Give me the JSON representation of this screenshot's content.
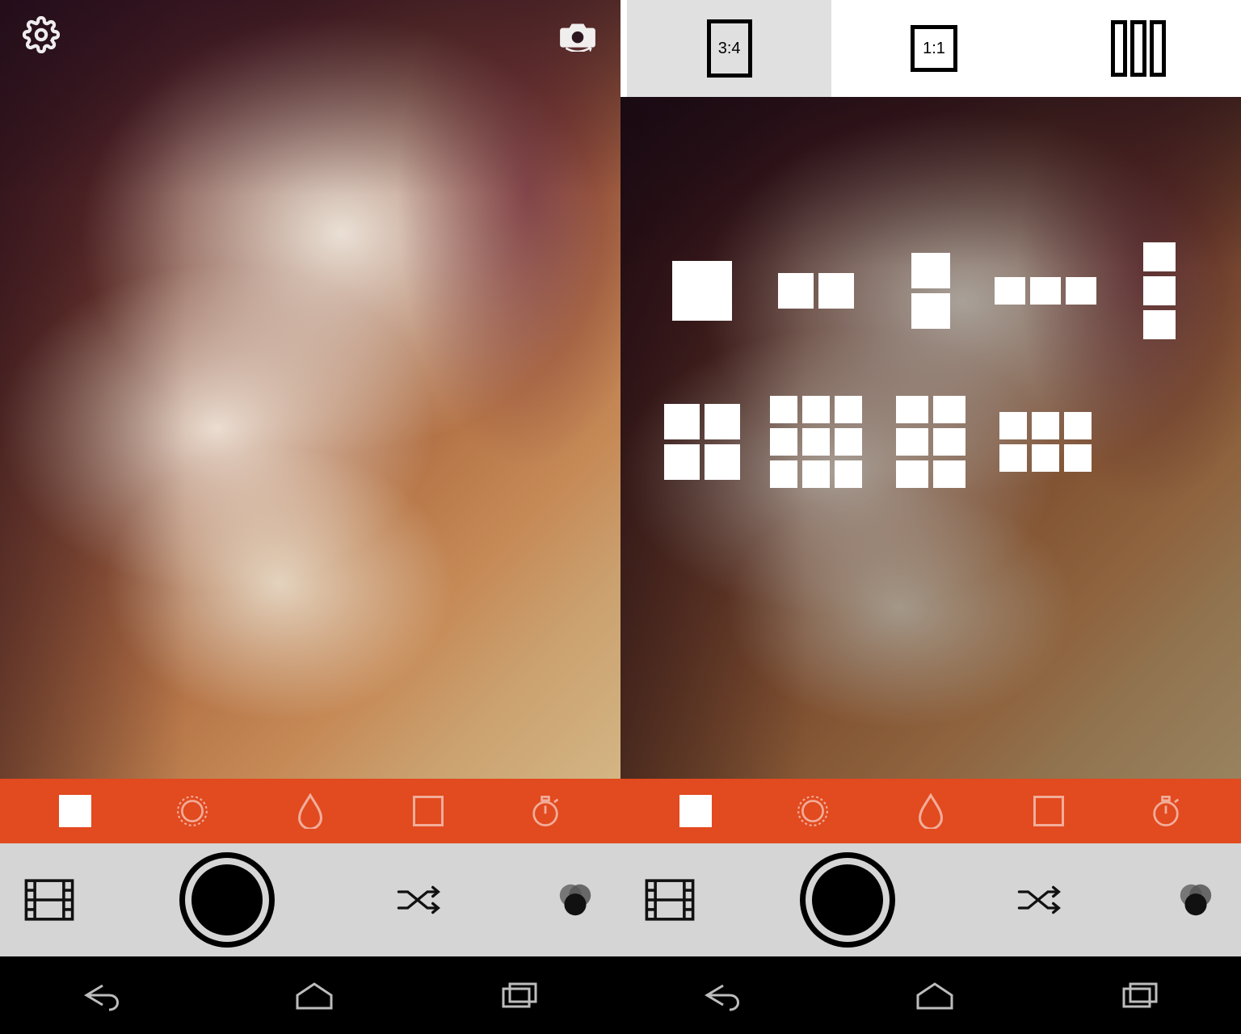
{
  "left": {
    "top_icons": {
      "settings": "gear-icon",
      "flip": "camera-flip-icon"
    },
    "filter_tabs": [
      "layout",
      "lens",
      "drop",
      "vignette",
      "timer"
    ],
    "filter_active": 0,
    "controls": {
      "gallery": "filmstrip-icon",
      "shutter": "shutter-button",
      "shuffle": "shuffle-icon",
      "color": "color-filter-icon"
    },
    "nav": [
      "back",
      "home",
      "recents"
    ]
  },
  "right": {
    "aspect": {
      "options": [
        {
          "id": "3-4",
          "label": "3:4",
          "selected": true
        },
        {
          "id": "1-1",
          "label": "1:1",
          "selected": false
        },
        {
          "id": "strip",
          "label": "",
          "selected": false
        }
      ]
    },
    "layouts": [
      "1x1",
      "2x1",
      "1x2",
      "3x1",
      "1x3",
      "2x2",
      "3x3",
      "2x3",
      "3x2"
    ],
    "filter_tabs": [
      "layout",
      "lens",
      "drop",
      "vignette",
      "timer"
    ],
    "filter_active": 0,
    "controls": {
      "gallery": "filmstrip-icon",
      "shutter": "shutter-button",
      "shuffle": "shuffle-icon",
      "color": "color-filter-icon"
    },
    "nav": [
      "back",
      "home",
      "recents"
    ]
  },
  "colors": {
    "accent": "#e24a1f",
    "control_bg": "#d5d5d5",
    "nav_bg": "#000000"
  }
}
